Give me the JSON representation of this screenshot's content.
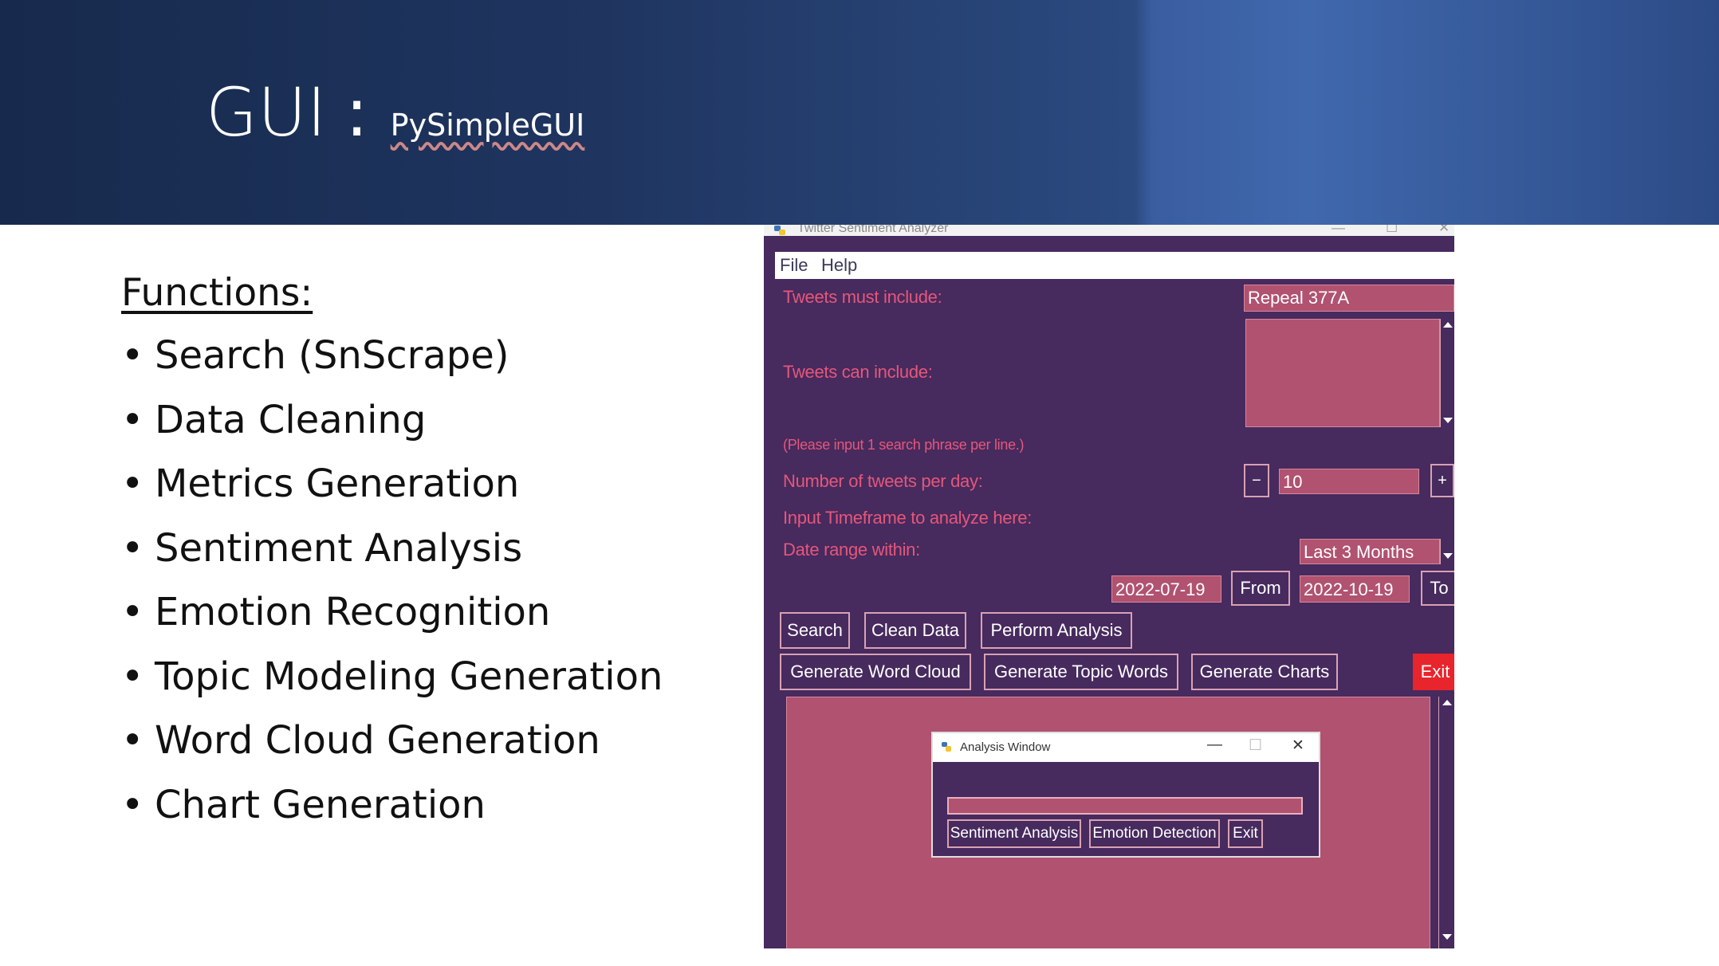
{
  "slide": {
    "title": "GUI",
    "separator": ":",
    "subtitle": "PySimpleGUI"
  },
  "functions": {
    "heading": "Functions:",
    "items": [
      "Search (SnScrape)",
      "Data Cleaning",
      "Metrics Generation",
      "Sentiment Analysis",
      "Emotion Recognition",
      "Topic Modeling Generation",
      "Word Cloud Generation",
      "Chart Generation"
    ]
  },
  "app": {
    "window_title": "Twitter Sentiment Analyzer",
    "menu": [
      "File",
      "Help"
    ],
    "labels": {
      "must_include": "Tweets must include:",
      "can_include": "Tweets can include:",
      "hint": "(Please input 1 search phrase per line.)",
      "tweets_per_day": "Number of tweets per day:",
      "timeframe": "Input Timeframe to analyze here:",
      "date_range": "Date range within:"
    },
    "fields": {
      "must_include_value": "Repeal 377A",
      "can_include_value": "",
      "tweets_per_day_value": "10",
      "date_range_value": "Last 3 Months",
      "from_date": "2022-07-19",
      "to_date": "2022-10-19"
    },
    "buttons": {
      "minus": "−",
      "plus": "+",
      "from": "From",
      "to": "To",
      "search": "Search",
      "clean": "Clean Data",
      "analysis": "Perform Analysis",
      "word_cloud": "Generate Word Cloud",
      "topic_words": "Generate Topic Words",
      "charts": "Generate Charts",
      "exit": "Exit"
    },
    "analysis_window": {
      "title": "Analysis Window",
      "buttons": {
        "sentiment": "Sentiment Analysis",
        "emotion": "Emotion Detection",
        "exit": "Exit"
      }
    }
  },
  "colors": {
    "app_bg": "#472a5e",
    "field_bg": "#b05270",
    "label_text": "#e5577a",
    "exit_button": "#e8242c",
    "header_bg": "#1f3560"
  }
}
